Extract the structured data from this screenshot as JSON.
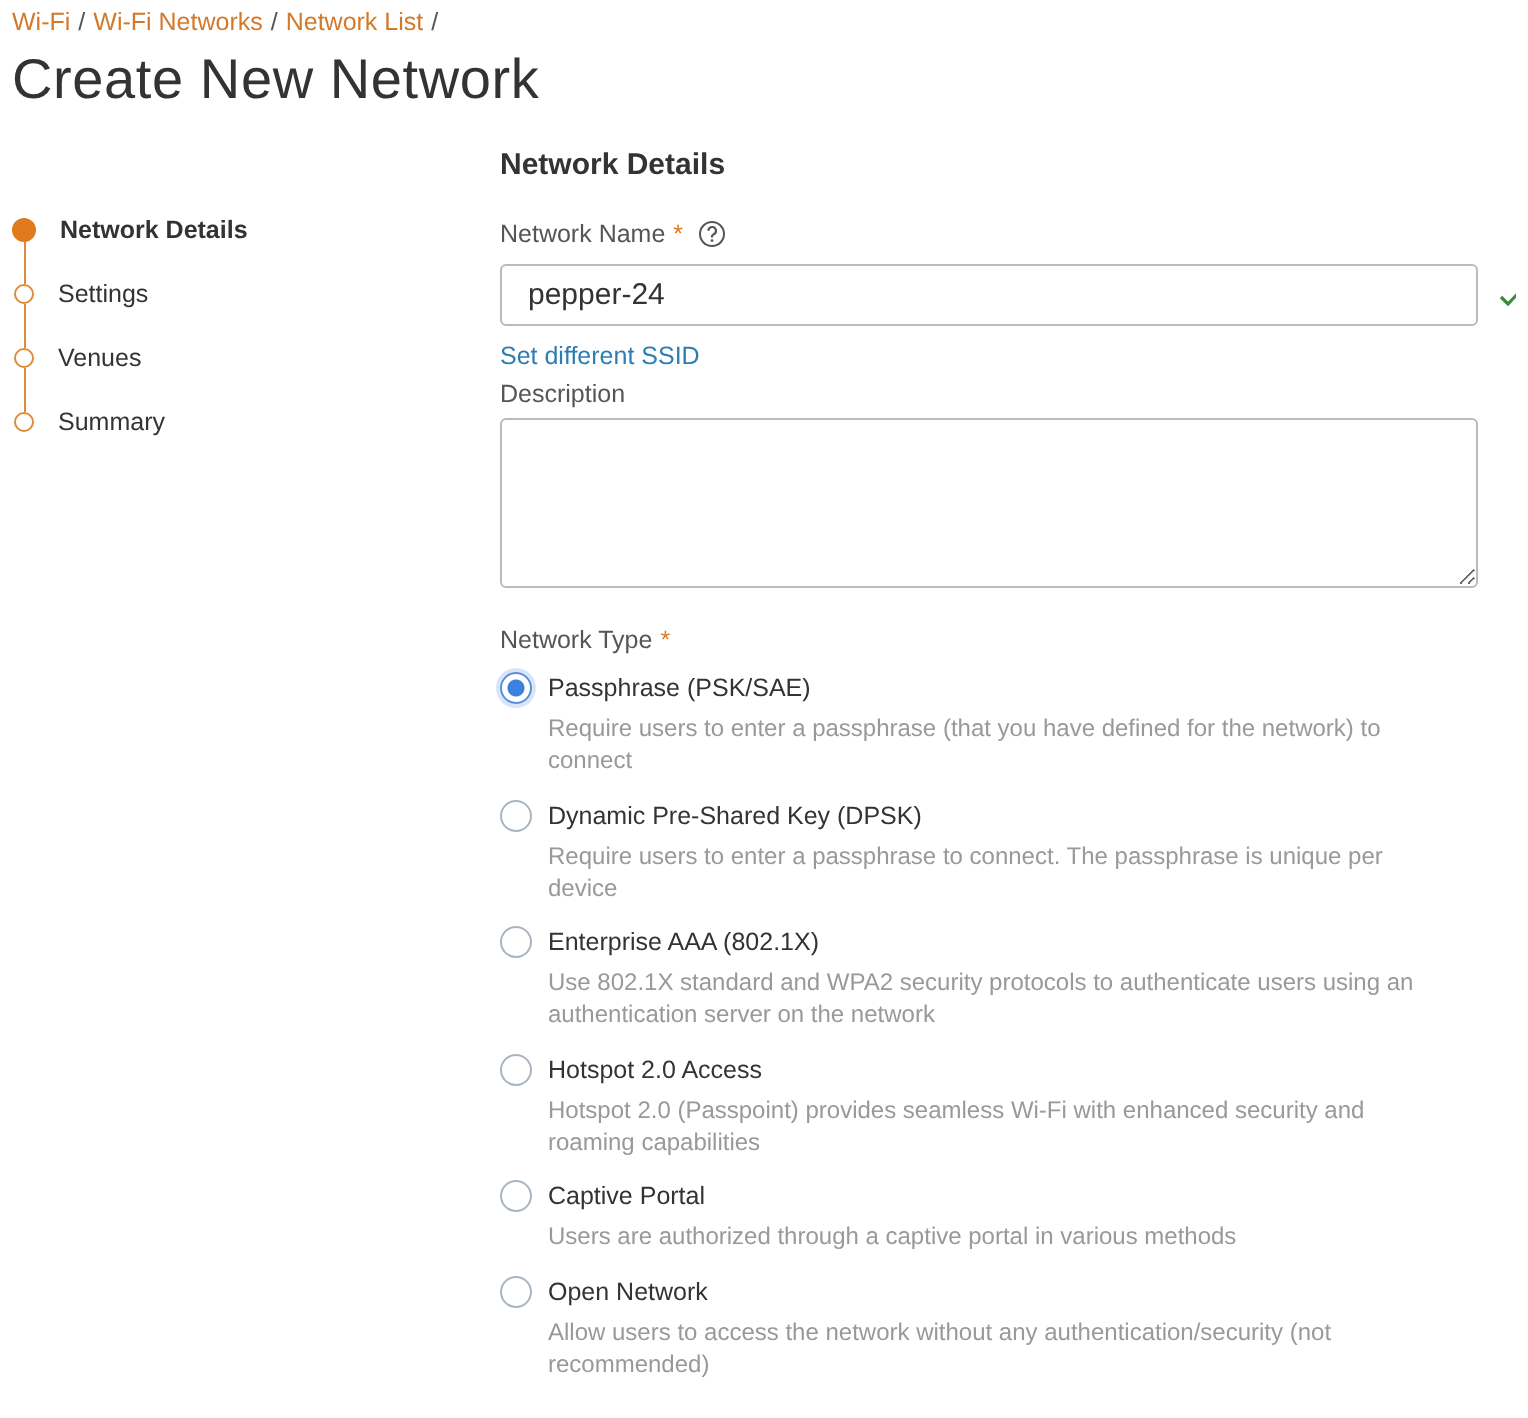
{
  "breadcrumb": [
    {
      "label": "Wi-Fi"
    },
    {
      "label": "Wi-Fi Networks"
    },
    {
      "label": "Network List"
    }
  ],
  "breadcrumb_separator": "/",
  "title": "Create New Network",
  "steps": [
    {
      "label": "Network Details",
      "selected": true
    },
    {
      "label": "Settings",
      "selected": false
    },
    {
      "label": "Venues",
      "selected": false
    },
    {
      "label": "Summary",
      "selected": false
    }
  ],
  "section_title": "Network Details",
  "network_name": {
    "label": "Network Name",
    "required_mark": "*",
    "value": "pepper-24",
    "valid": true
  },
  "ssid_link": "Set different SSID",
  "description": {
    "label": "Description"
  },
  "network_type": {
    "label": "Network Type",
    "required_mark": "*",
    "options": [
      {
        "title": "Passphrase (PSK/SAE)",
        "description": "Require users to enter a passphrase (that you have defined for the network) to connect",
        "selected": true
      },
      {
        "title": "Dynamic Pre-Shared Key (DPSK)",
        "description": "Require users to enter a passphrase to connect. The passphrase is unique per device",
        "selected": false
      },
      {
        "title": "Enterprise AAA (802.1X)",
        "description": "Use 802.1X standard and WPA2 security protocols to authenticate users using an authentication server on the network",
        "selected": false
      },
      {
        "title": "Hotspot 2.0 Access",
        "description": "Hotspot 2.0 (Passpoint) provides seamless Wi-Fi with enhanced security and roaming capabilities",
        "selected": false
      },
      {
        "title": "Captive Portal",
        "description": "Users are authorized through a captive portal in various methods",
        "selected": false
      },
      {
        "title": "Open Network",
        "description": "Allow users to access the network without any authentication/security (not recommended)",
        "selected": false
      }
    ]
  }
}
